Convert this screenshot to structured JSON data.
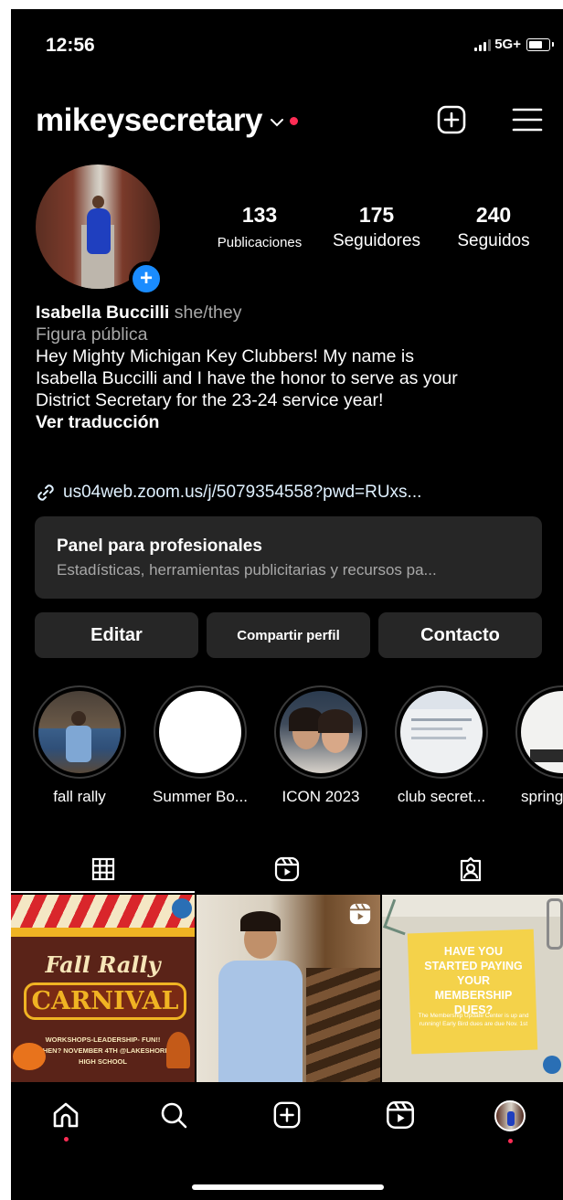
{
  "status_bar": {
    "time": "12:56",
    "network": "5G+"
  },
  "header": {
    "username": "mikeysecretary"
  },
  "stats": [
    {
      "count": "133",
      "label": "Publicaciones"
    },
    {
      "count": "175",
      "label": "Seguidores"
    },
    {
      "count": "240",
      "label": "Seguidos"
    }
  ],
  "avatar_badge": "+",
  "bio": {
    "name": "Isabella Buccilli",
    "pronouns": "she/they",
    "category": "Figura pública",
    "lines": [
      "Hey Mighty Michigan Key Clubbers! My name is",
      "Isabella Buccilli and I have the honor to serve as your",
      "District Secretary for the 23-24 service year!"
    ],
    "translate": "Ver traducción",
    "link": "us04web.zoom.us/j/5079354558?pwd=RUxs..."
  },
  "pro_panel": {
    "title": "Panel para profesionales",
    "subtitle": "Estadísticas, herramientas publicitarias y recursos pa..."
  },
  "buttons": {
    "edit": "Editar",
    "share": "Compartir perfil",
    "contact": "Contacto"
  },
  "highlights": [
    {
      "label": "fall rally"
    },
    {
      "label": "Summer Bo..."
    },
    {
      "label": "ICON 2023"
    },
    {
      "label": "club secret..."
    },
    {
      "label": "spring"
    }
  ],
  "posts": [
    {
      "title_1": "Fall Rally",
      "title_2": "CARNIVAL",
      "line_1": "WORKSHOPS-LEADERSHIP- FUN!!",
      "line_2": "WHEN? NOVEMBER 4TH @LAKESHORE",
      "line_3": "HIGH SCHOOL"
    },
    {
      "type": "reel"
    },
    {
      "headline": "HAVE YOU STARTED PAYING YOUR MEMBERSHIP DUES?",
      "body": "The Membership Update Center is up and running! Early Bird dues are due Nov. 1st"
    }
  ],
  "colors": {
    "background": "#000000",
    "surface": "#262626",
    "accent": "#1a8cff",
    "notification": "#ff2d55",
    "link": "#e0f1ff",
    "muted": "#a8a8a8"
  }
}
